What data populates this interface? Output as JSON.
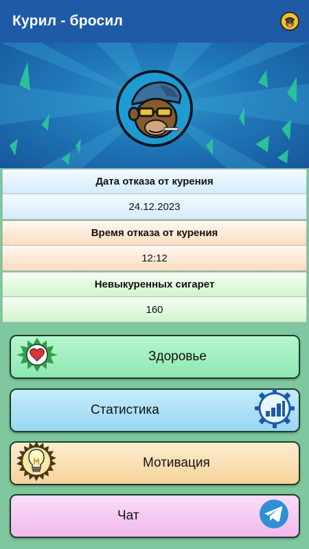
{
  "app": {
    "title": "Курил - бросил",
    "avatar_icon": "monkey-avatar-icon"
  },
  "hero": {
    "logo_icon": "monkey-logo-icon",
    "colors": {
      "bg_light": "#2f97c9",
      "bg_dark": "#17579b",
      "shard": "#2bbf9a"
    }
  },
  "info": [
    {
      "label": "Дата отказа от курения",
      "value": "24.12.2023",
      "color": "#d4ecfb"
    },
    {
      "label": "Время отказа от курения",
      "value": "12:12",
      "color": "#fbdcc0"
    },
    {
      "label": "Невыкуренных сигарет",
      "value": "160",
      "color": "#d2f3cc"
    }
  ],
  "menu": [
    {
      "label": "Здоровье",
      "icon": "heart-icon",
      "color": "#8ee7b1"
    },
    {
      "label": "Статистика",
      "icon": "bar-chart-gear-icon",
      "color": "#98d6f1"
    },
    {
      "label": "Мотивация",
      "icon": "light-bulb-icon",
      "color": "#f6d39a"
    },
    {
      "label": "Чат",
      "icon": "telegram-icon",
      "color": "#f1b8ee"
    }
  ]
}
